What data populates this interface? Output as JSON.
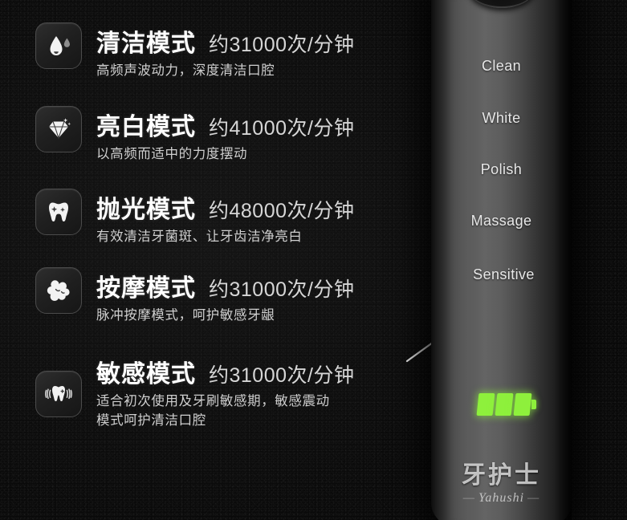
{
  "background": {
    "color": "#0b0b0b",
    "texture": "noise"
  },
  "features": [
    {
      "icon": "water-drop-icon",
      "name": "清洁模式",
      "frequency": "约31000次/分钟",
      "description_line1": "高频声波动力，深度清洁口腔",
      "description_line2": ""
    },
    {
      "icon": "diamond-sparkle-icon",
      "name": "亮白模式",
      "frequency": "约41000次/分钟",
      "description_line1": "以高频而适中的力度摆动",
      "description_line2": ""
    },
    {
      "icon": "tooth-sparkle-icon",
      "name": "抛光模式",
      "frequency": "约48000次/分钟",
      "description_line1": "有效清洁牙菌斑、让牙齿洁净亮白",
      "description_line2": ""
    },
    {
      "icon": "bubble-cluster-icon",
      "name": "按摩模式",
      "frequency": "约31000次/分钟",
      "description_line1": "脉冲按摩模式，呵护敏感牙龈",
      "description_line2": ""
    },
    {
      "icon": "tooth-vibration-icon",
      "name": "敏感模式",
      "frequency": "约31000次/分钟",
      "description_line1": "适合初次使用及牙刷敏感期，敏感震动",
      "description_line2": "模式呵护清洁口腔"
    }
  ],
  "device": {
    "mode_labels": [
      "Clean",
      "White",
      "Polish",
      "Massage",
      "Sensitive"
    ],
    "battery": {
      "bars": 3,
      "color": "#8ef03c"
    },
    "brand_cn": "牙护士",
    "brand_en": "Yahushi"
  }
}
